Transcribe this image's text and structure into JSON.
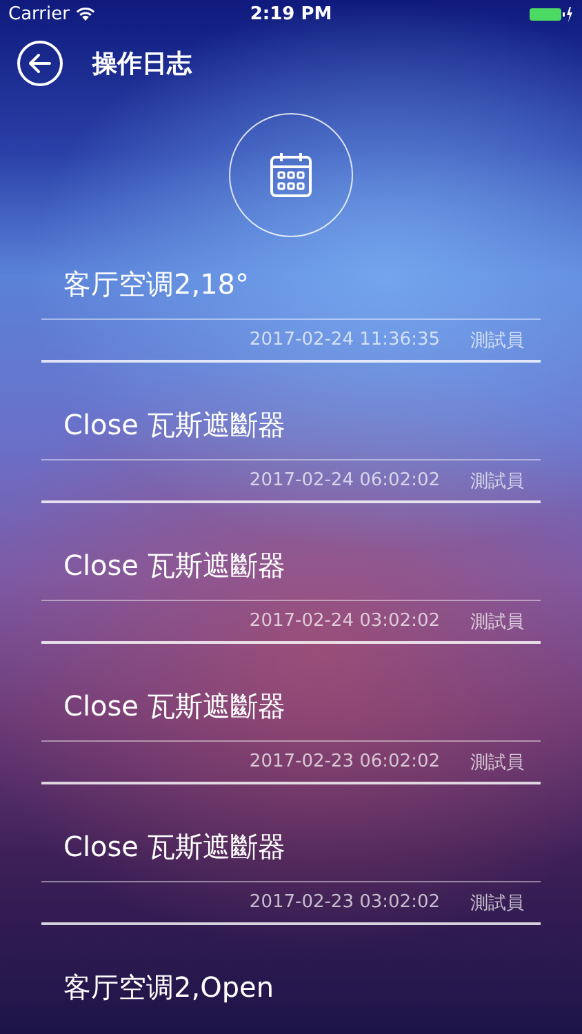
{
  "status_bar": {
    "carrier": "Carrier",
    "time": "2:19 PM"
  },
  "nav": {
    "title": "操作日志"
  },
  "entries": [
    {
      "title": "客厅空调2,18°",
      "time": "2017-02-24 11:36:35",
      "user": "測試員"
    },
    {
      "title": "Close 瓦斯遮斷器",
      "time": "2017-02-24 06:02:02",
      "user": "測試員"
    },
    {
      "title": "Close 瓦斯遮斷器",
      "time": "2017-02-24 03:02:02",
      "user": "測試員"
    },
    {
      "title": "Close 瓦斯遮斷器",
      "time": "2017-02-23 06:02:02",
      "user": "測試員"
    },
    {
      "title": "Close 瓦斯遮斷器",
      "time": "2017-02-23 03:02:02",
      "user": "測試員"
    },
    {
      "title": "客厅空调2,Open"
    }
  ]
}
